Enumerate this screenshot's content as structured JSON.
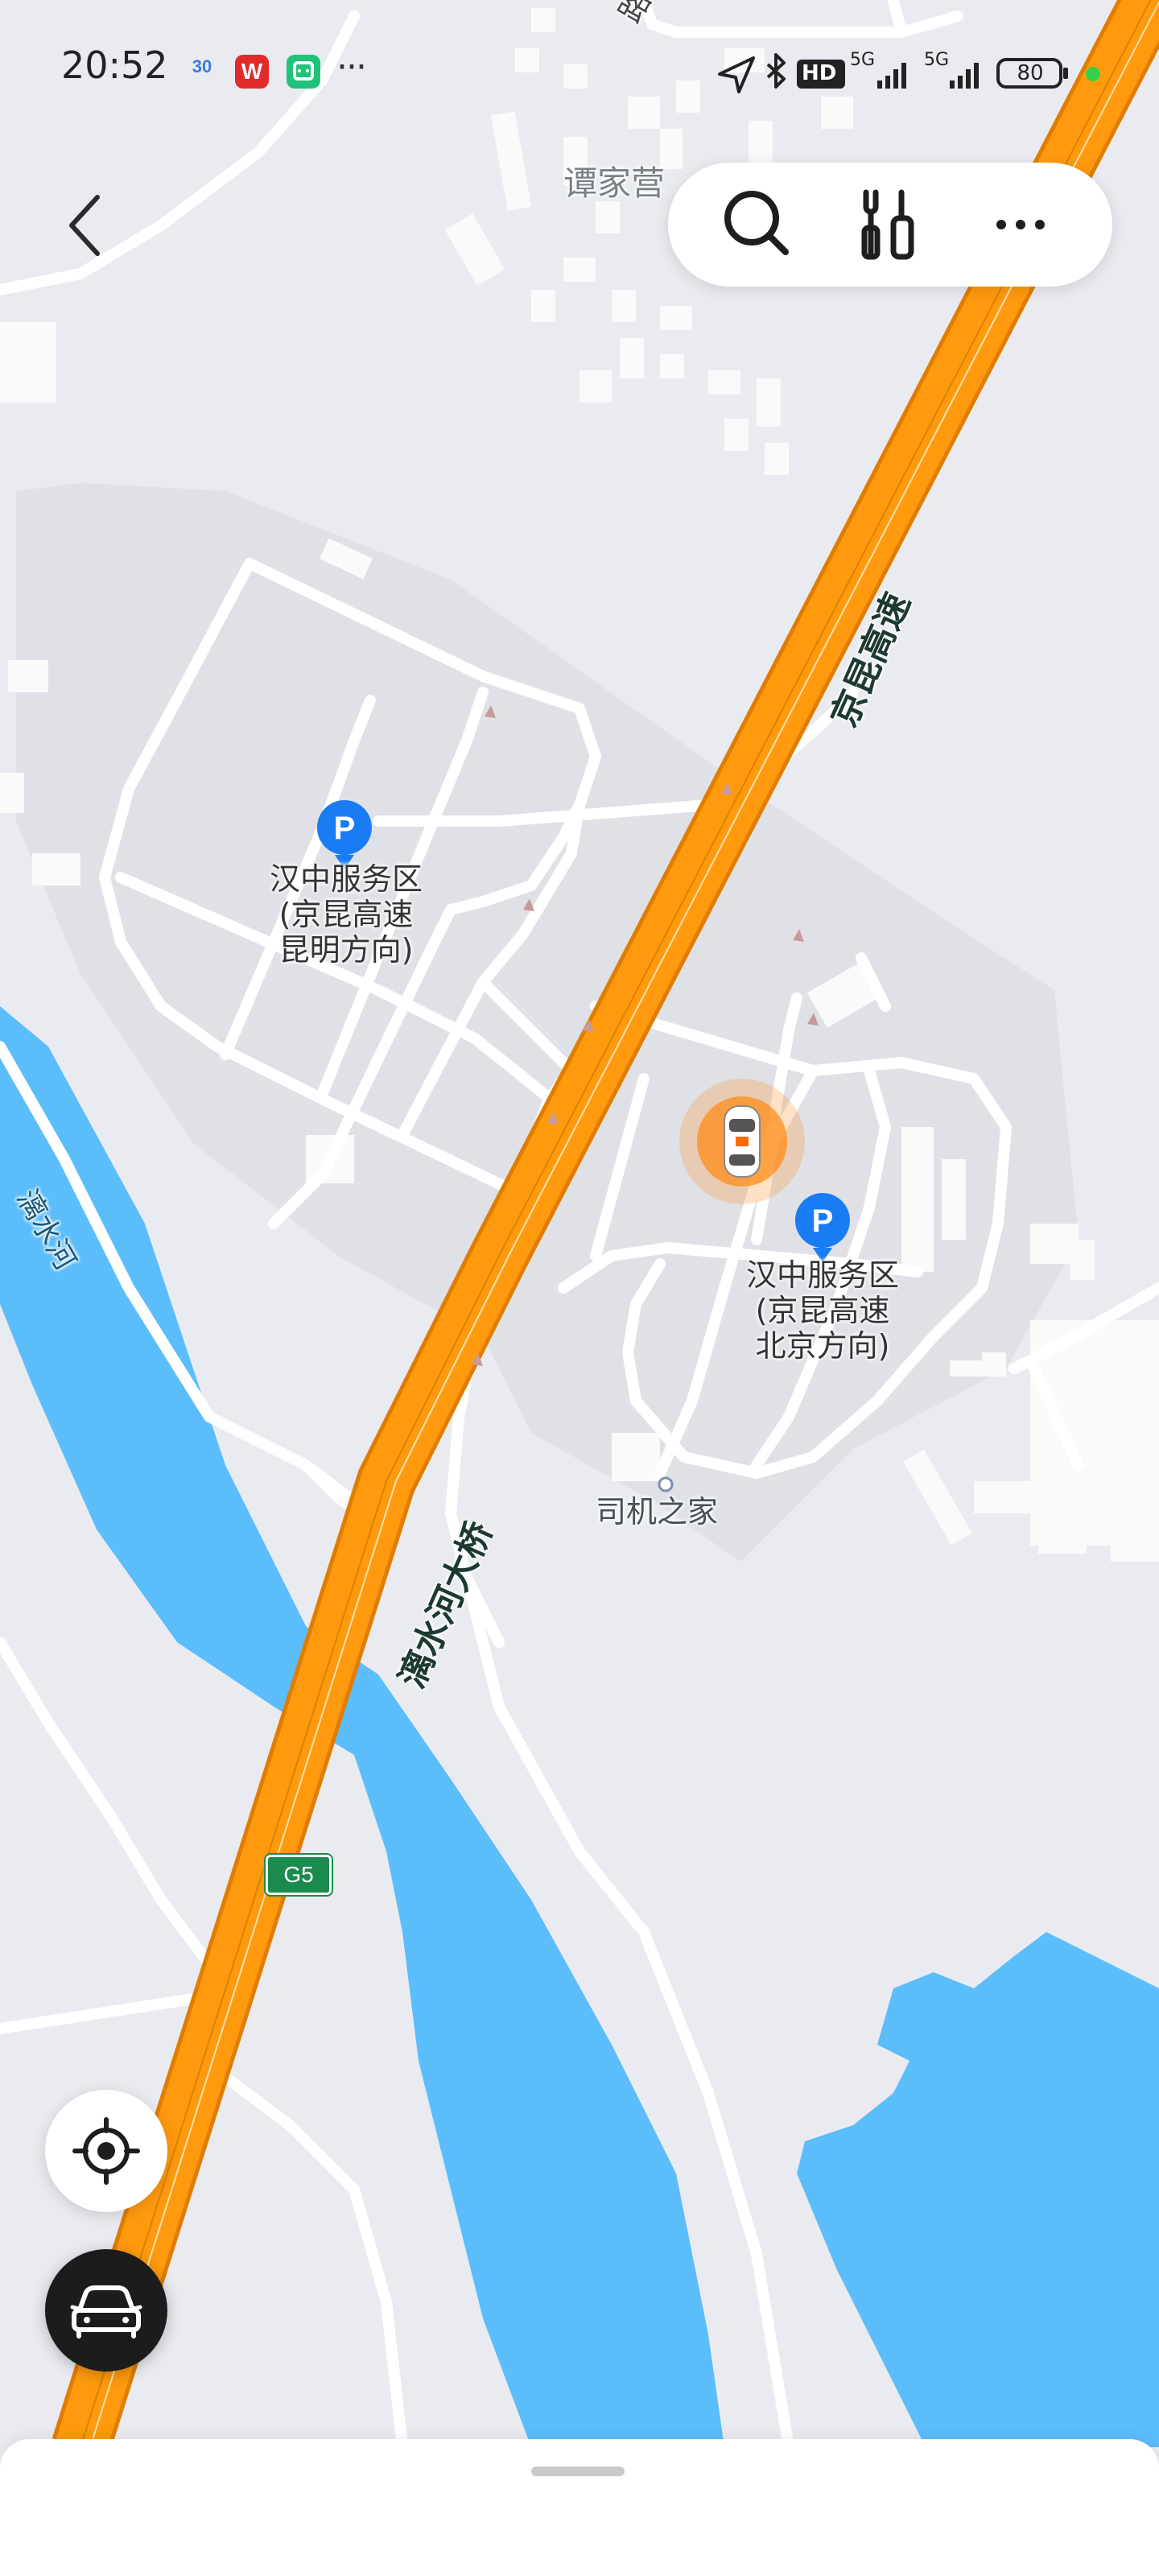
{
  "status_bar": {
    "time": "20:52",
    "calendar_icon_text": "30",
    "wps_icon_text": "W",
    "more_dots": "···",
    "hd_badge": "HD",
    "network_1": "5G",
    "network_2": "5G",
    "battery": "80"
  },
  "top_bar": {
    "back_icon": "chevron-left-icon",
    "search_icon": "search-icon",
    "tools_icon": "tools-icon",
    "more_icon": "more-horizontal-icon"
  },
  "map": {
    "labels": {
      "village": "谭家营",
      "expressway": "京昆高速",
      "bridge": "漓水河大桥",
      "river": "漓水河",
      "partial_road": "路",
      "service_area_west": {
        "line1": "汉中服务区",
        "line2": "(京昆高速",
        "line3": "昆明方向)"
      },
      "service_area_east": {
        "line1": "汉中服务区",
        "line2": "(京昆高速",
        "line3": "北京方向)"
      },
      "driver_home": "司机之家",
      "highway_shield": "G5"
    },
    "colors": {
      "background": "#e9ebf0",
      "highway": "#ff9a0e",
      "water": "#5cbdfb",
      "service_area": "#dfe1e6",
      "minor_road": "#ffffff",
      "poi_marker": "#1a7cf5",
      "vehicle_glow": "#ff8c1a"
    }
  },
  "controls": {
    "locate_icon": "crosshair-icon",
    "vehicle_icon": "car-icon"
  }
}
